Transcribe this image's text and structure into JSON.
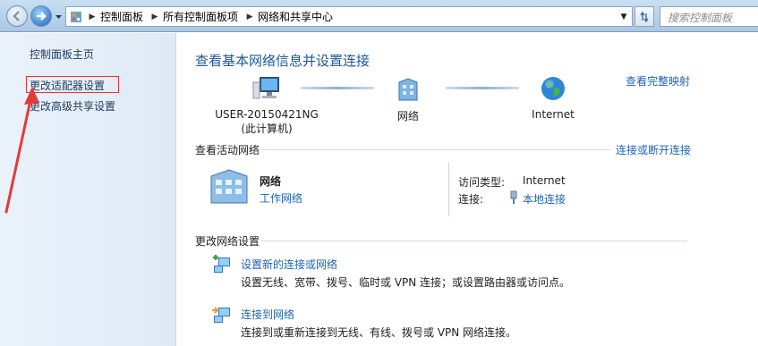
{
  "address_bar": {
    "breadcrumbs": [
      "控制面板",
      "所有控制面板项",
      "网络和共享中心"
    ],
    "search_placeholder": "搜索控制面板"
  },
  "sidebar": {
    "home": "控制面板主页",
    "adapter_settings": "更改适配器设置",
    "advanced_sharing": "更改高级共享设置"
  },
  "main": {
    "title": "查看基本网络信息并设置连接",
    "full_map_link": "查看完整映射",
    "map": {
      "computer_name": "USER-20150421NG",
      "computer_sub": "(此计算机)",
      "network": "网络",
      "internet": "Internet"
    },
    "active_networks": {
      "heading": "查看活动网络",
      "connect_link": "连接或断开连接",
      "network_name": "网络",
      "network_type": "工作网络",
      "access_type_label": "访问类型:",
      "access_type_value": "Internet",
      "connections_label": "连接:",
      "connections_value": "本地连接"
    },
    "change_settings": {
      "heading": "更改网络设置",
      "tasks": [
        {
          "link": "设置新的连接或网络",
          "desc": "设置无线、宽带、拨号、临时或 VPN 连接；或设置路由器或访问点。"
        },
        {
          "link": "连接到网络",
          "desc": "连接到或重新连接到无线、有线、拨号或 VPN 网络连接。"
        }
      ]
    }
  },
  "colors": {
    "link": "#1e64b4",
    "title": "#1e5797",
    "highlight_box": "#e03434"
  }
}
